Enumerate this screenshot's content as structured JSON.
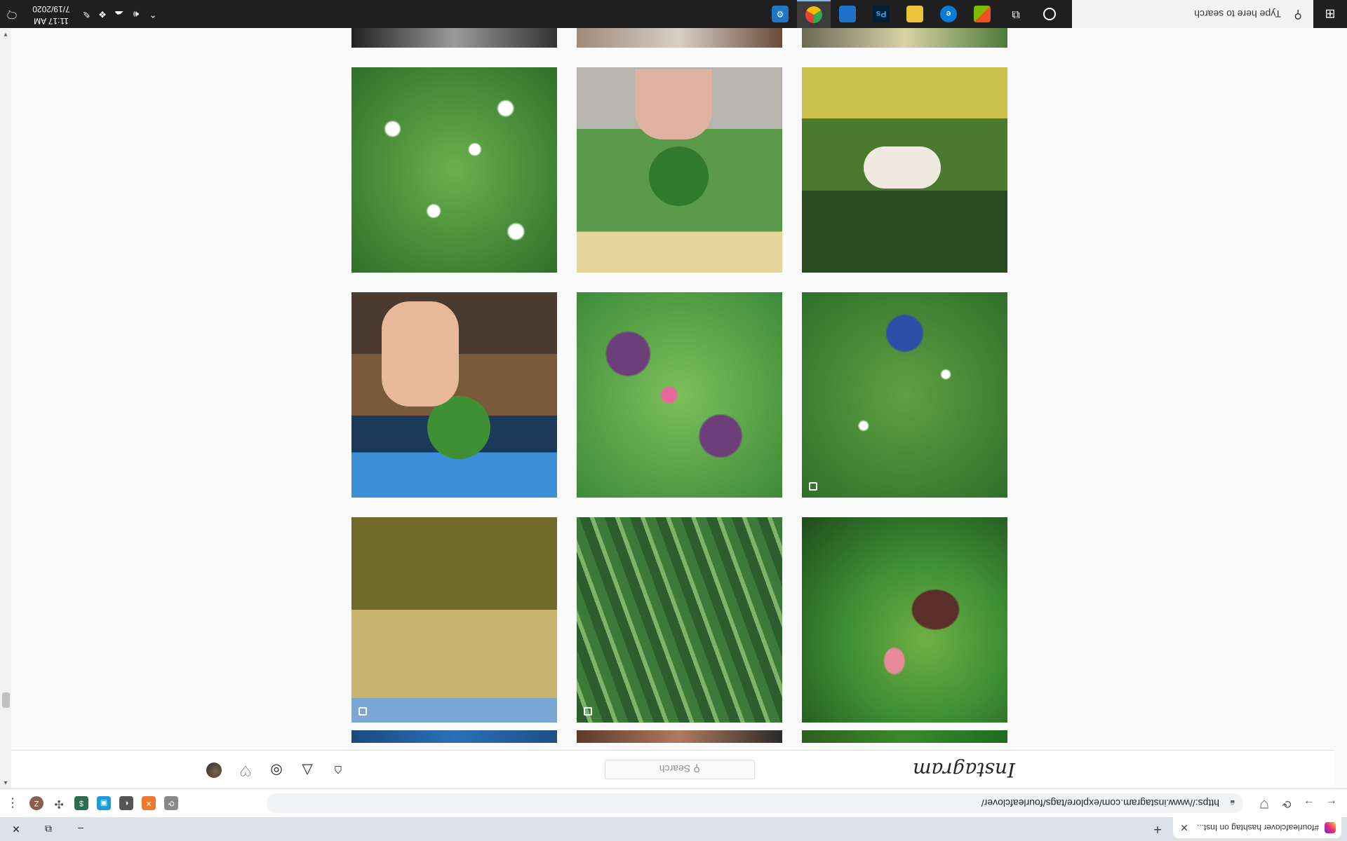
{
  "browser": {
    "tab_title": "#fourleafclover hashtag on Inst...",
    "tab_close": "✕",
    "new_tab": "+",
    "url": "https://www.instagram.com/explore/tags/fourleafclover/",
    "profile_initial": "Z",
    "window_min": "–",
    "window_restore": "⧉",
    "window_close": "✕"
  },
  "instagram": {
    "logo": "Instagram",
    "search_placeholder": "Search"
  },
  "taskbar": {
    "search_placeholder": "Type here to search",
    "time": "11:17 AM",
    "date": "7/19/2020"
  },
  "colors": {
    "clover_green": "#3f8f35",
    "dark_green": "#1f4d1c",
    "sky_blue": "#3a8fd6",
    "purple_leaf": "#6d3f7a",
    "instagram_gradient": [
      "#f9ce34",
      "#ee2a7b",
      "#6228d7"
    ]
  },
  "grid": {
    "tiles": [
      {
        "name": "white-clover-flowers-photo"
      },
      {
        "name": "hand-holding-clover-nails-photo"
      },
      {
        "name": "woman-in-yellow-flowers-photo"
      },
      {
        "name": "hand-holding-four-leaf-clover-photo"
      },
      {
        "name": "purple-oxalis-clover-photo"
      },
      {
        "name": "sneaker-in-clover-field-photo",
        "carousel": true
      },
      {
        "name": "bicycle-in-meadow-photo",
        "carousel": true
      },
      {
        "name": "clover-and-grass-photo",
        "carousel": true
      },
      {
        "name": "hand-holding-iron-cross-clover-photo"
      }
    ]
  }
}
